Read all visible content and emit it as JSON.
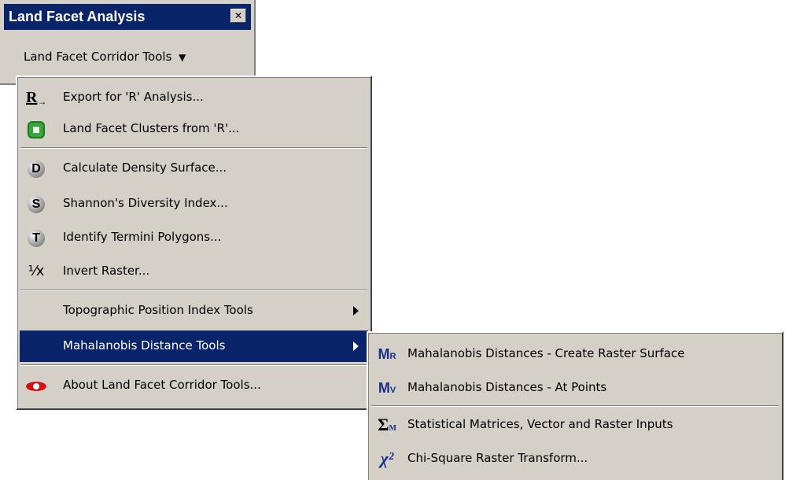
{
  "toolbar": {
    "title": "Land Facet Analysis",
    "close_glyph": "✕",
    "dropdown_label": "Land Facet Corridor Tools",
    "dropdown_arrow": "▼"
  },
  "menu": {
    "items": [
      {
        "label": "Export for 'R' Analysis...",
        "icon": "r-export-icon",
        "glyph": "R→"
      },
      {
        "label": "Land Facet Clusters from 'R'...",
        "icon": "green-cluster-icon"
      },
      {
        "label": "Calculate Density Surface...",
        "icon": "d-circle-icon",
        "glyph": "D"
      },
      {
        "label": "Shannon's Diversity Index...",
        "icon": "s-circle-icon",
        "glyph": "S"
      },
      {
        "label": "Identify Termini Polygons...",
        "icon": "t-circle-icon",
        "glyph": "T"
      },
      {
        "label": "Invert Raster...",
        "icon": "invert-icon",
        "glyph": "⅟x"
      },
      {
        "label": "Topographic Position Index Tools"
      },
      {
        "label": "Mahalanobis Distance Tools"
      },
      {
        "label": "About Land Facet Corridor Tools...",
        "icon": "eye-icon"
      }
    ]
  },
  "submenu": {
    "items": [
      {
        "label": "Mahalanobis Distances - Create Raster Surface",
        "icon": "mr-icon",
        "glyph": "M",
        "sub": "R"
      },
      {
        "label": "Mahalanobis Distances - At Points",
        "icon": "mv-icon",
        "glyph": "M",
        "sub": "V"
      },
      {
        "label": "Statistical Matrices, Vector and Raster Inputs",
        "icon": "sigma-icon",
        "glyph": "Σ",
        "sub": "M"
      },
      {
        "label": "Chi-Square Raster Transform...",
        "icon": "chi-square-icon",
        "glyph": "χ²"
      }
    ]
  },
  "colors": {
    "face": "#d4d0c8",
    "highlight": "#0a246a"
  }
}
